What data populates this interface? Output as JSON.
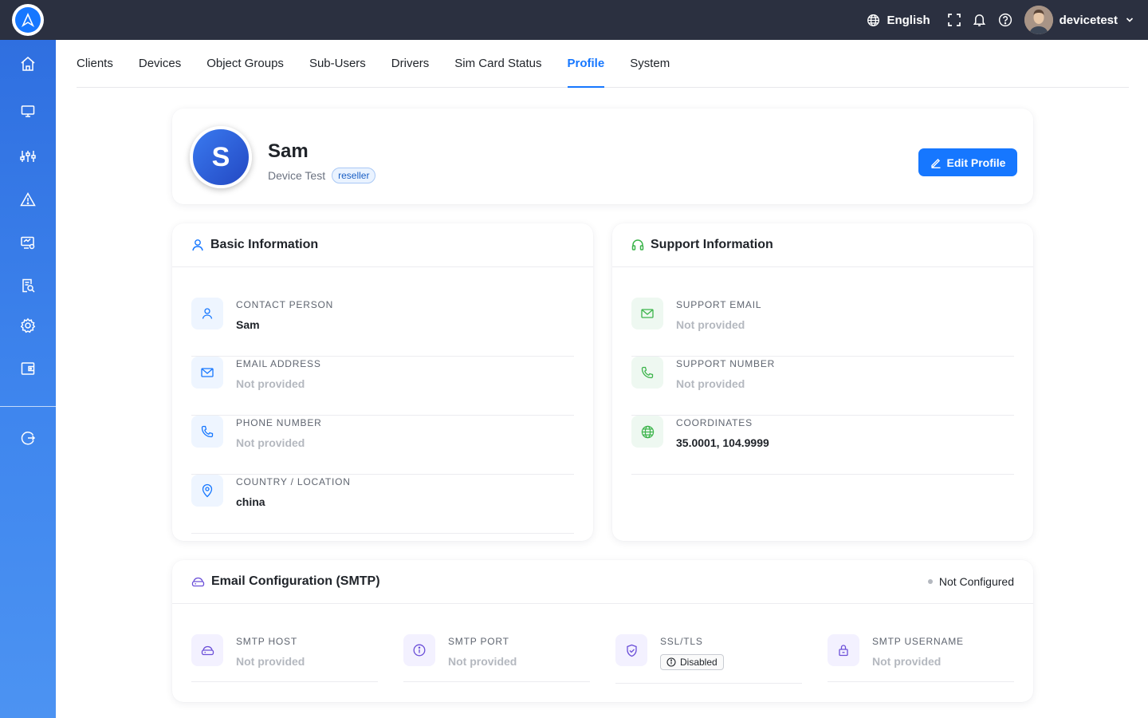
{
  "header": {
    "language": "English",
    "username": "devicetest"
  },
  "tabs": [
    "Clients",
    "Devices",
    "Object Groups",
    "Sub-Users",
    "Drivers",
    "Sim Card Status",
    "Profile",
    "System"
  ],
  "active_tab": "Profile",
  "profile": {
    "initial": "S",
    "name": "Sam",
    "company": "Device Test",
    "role": "reseller",
    "edit_label": "Edit Profile"
  },
  "basic_info": {
    "title": "Basic Information",
    "fields": [
      {
        "label": "CONTACT PERSON",
        "value": "Sam"
      },
      {
        "label": "EMAIL ADDRESS",
        "value": "Not provided"
      },
      {
        "label": "PHONE NUMBER",
        "value": "Not provided"
      },
      {
        "label": "COUNTRY / LOCATION",
        "value": "china"
      }
    ]
  },
  "support_info": {
    "title": "Support Information",
    "fields": [
      {
        "label": "SUPPORT EMAIL",
        "value": "Not provided"
      },
      {
        "label": "SUPPORT NUMBER",
        "value": "Not provided"
      },
      {
        "label": "COORDINATES",
        "value": "35.0001, 104.9999"
      }
    ]
  },
  "smtp": {
    "title": "Email Configuration (SMTP)",
    "status": "Not Configured",
    "fields": [
      {
        "label": "SMTP HOST",
        "value": "Not provided"
      },
      {
        "label": "SMTP PORT",
        "value": "Not provided"
      },
      {
        "label": "SSL/TLS",
        "value": "Disabled"
      },
      {
        "label": "SMTP USERNAME",
        "value": "Not provided"
      }
    ]
  },
  "colors": {
    "primary": "#1677ff",
    "topbar": "#2b3040",
    "sidebar": "#3a7ded",
    "support_accent": "#3cb44b",
    "smtp_accent": "#6b4fd8"
  },
  "sidebar_icons": [
    "home-icon",
    "monitor-icon",
    "sliders-icon",
    "alert-icon",
    "device-settings-icon",
    "report-search-icon",
    "gear-icon",
    "wallet-icon",
    "logout-icon"
  ]
}
